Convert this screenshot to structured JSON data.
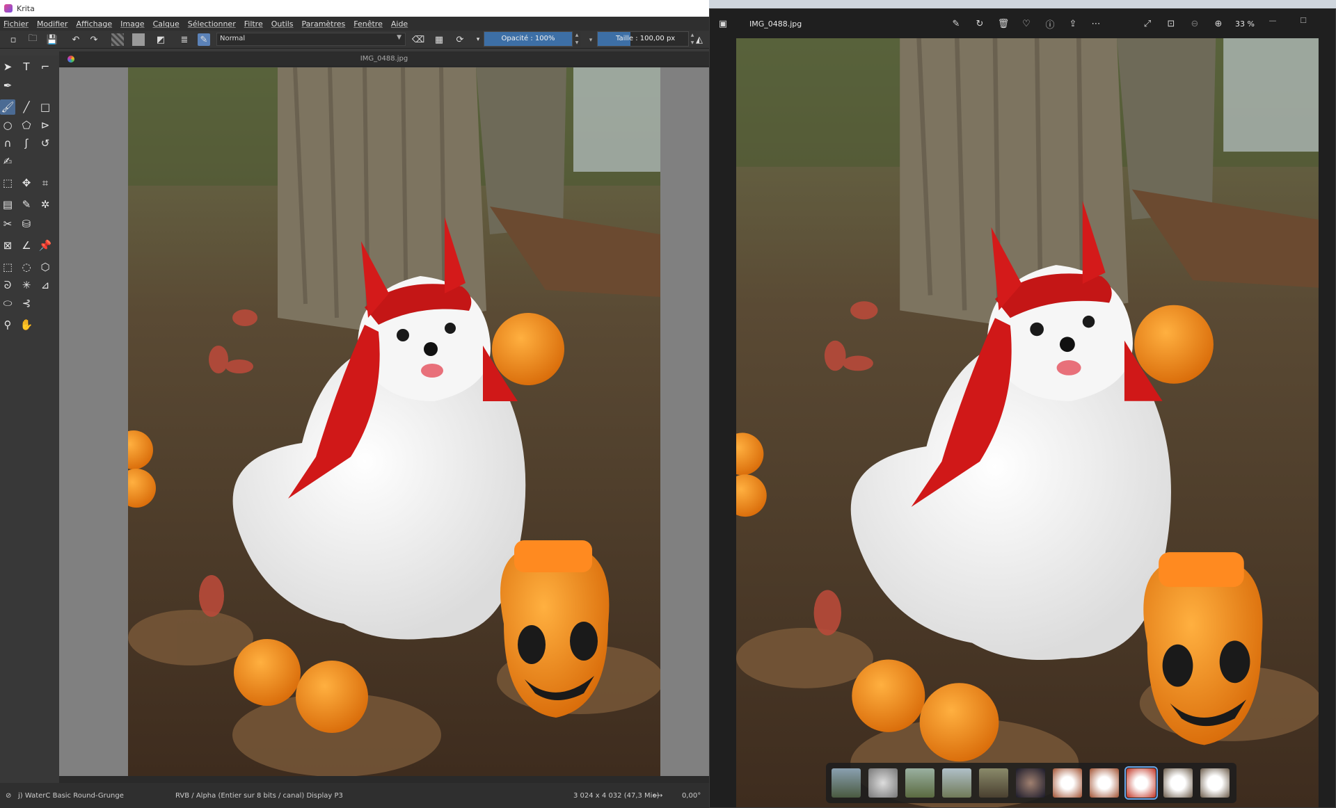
{
  "krita": {
    "title": "Krita",
    "menu": [
      "Fichier",
      "Modifier",
      "Affichage",
      "Image",
      "Calque",
      "Sélectionner",
      "Filtre",
      "Outils",
      "Paramètres",
      "Fenêtre",
      "Aide"
    ],
    "blend_mode": "Normal",
    "opacity_label": "Opacité : 100%",
    "opacity_value": 100,
    "size_label": "Taille : 100,00 px",
    "size_value": 100,
    "document_tab": "IMG_0488.jpg",
    "status": {
      "brush": "j) WaterC Basic Round-Grunge",
      "color_space": "RVB / Alpha (Entier sur 8 bits / canal)  Display P3",
      "dimensions": "3 024 x 4 032 (47,3 Mio)",
      "rotation": "0,00°"
    }
  },
  "photos": {
    "file_name": "IMG_0488.jpg",
    "zoom": "33 %",
    "filmstrip_count": 11,
    "selected_thumb": 8
  },
  "icons": {
    "krita_logo": "krita-logo-icon",
    "photos_app": "photos-app-icon"
  },
  "colors": {
    "krita_accent": "#3d6fa6",
    "photos_selection": "#6aa6e8",
    "pumpkin": "#f07d10",
    "costume_red": "#d01818"
  }
}
